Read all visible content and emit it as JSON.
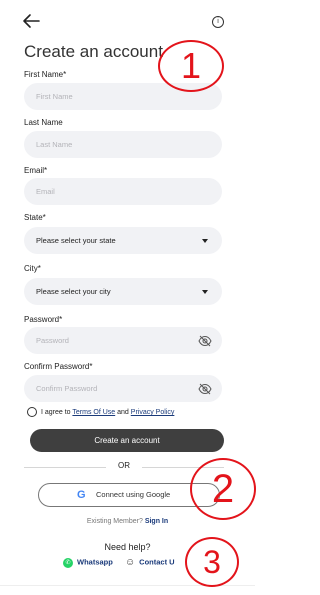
{
  "header": {
    "back_icon": "arrow-left-icon",
    "info_icon": "info-icon",
    "info_glyph": "i"
  },
  "title": "Create an account",
  "fields": {
    "first_name": {
      "label": "First Name*",
      "placeholder": "First Name"
    },
    "last_name": {
      "label": "Last Name",
      "placeholder": "Last Name"
    },
    "email": {
      "label": "Email*",
      "placeholder": "Email"
    },
    "state": {
      "label": "State*",
      "value": "Please select your state"
    },
    "city": {
      "label": "City*",
      "value": "Please select your city"
    },
    "password": {
      "label": "Password*",
      "placeholder": "Password"
    },
    "confirm_password": {
      "label": "Confirm Password*",
      "placeholder": "Confirm Password"
    }
  },
  "terms": {
    "prefix": "I agree to ",
    "terms_link": "Terms Of Use",
    "and": " and ",
    "privacy_link": "Privacy Policy"
  },
  "primary_button": "Create an account",
  "or": "OR",
  "google_button": "Connect using Google",
  "google_glyph": "G",
  "existing": {
    "text": "Existing Member? ",
    "link": "Sign In"
  },
  "help": {
    "title": "Need help?",
    "whatsapp": "Whatsapp",
    "contact": "Contact U"
  },
  "annotations": [
    "1",
    "2",
    "3"
  ],
  "colors": {
    "annotation": "#e3141b",
    "primary_button": "#3f3f3f",
    "link": "#1a3a7a",
    "field_bg": "#f1f2f5"
  }
}
